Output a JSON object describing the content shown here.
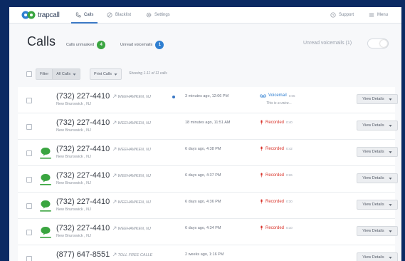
{
  "brand": {
    "name": "trapcall"
  },
  "nav": {
    "items": [
      {
        "label": "Calls",
        "icon": "phone-icon",
        "active": true
      },
      {
        "label": "Blacklist",
        "icon": "block-icon",
        "active": false
      },
      {
        "label": "Settings",
        "icon": "gear-icon",
        "active": false
      }
    ],
    "support": "Support",
    "menu": "Menu"
  },
  "header": {
    "title": "Calls",
    "calls_unmasked_label": "Calls unmasked",
    "calls_unmasked_count": "4",
    "unread_voicemails_label": "Unread voicemails",
    "unread_voicemails_count": "1",
    "unread_toggle_label": "Unread voicemails (1)"
  },
  "filter": {
    "filter_label": "Filter",
    "selected": "All Calls",
    "print_label": "Print Calls",
    "showing_text": "Showing 1-11 of 11 calls"
  },
  "calls": [
    {
      "phone": "(732) 227-4410",
      "location": "New Brunswick , NJ",
      "carrier": "WEEHAWKEN, NJ",
      "time": "3 minutes ago, 12:06 PM",
      "status": "Voicemail",
      "status_type": "voicemail",
      "duration": "0:05",
      "snippet": "This is a voice...",
      "unmasked": false,
      "unread": true,
      "action": "View Details"
    },
    {
      "phone": "(732) 227-4410",
      "location": "New Brunswick , NJ",
      "carrier": "WEEHAWKEN, NJ",
      "time": "18 minutes ago, 11:51 AM",
      "status": "Recorded",
      "status_type": "recorded",
      "duration": "0:40",
      "snippet": "",
      "unmasked": false,
      "unread": false,
      "action": "View Details"
    },
    {
      "phone": "(732) 227-4410",
      "location": "New Brunswick , NJ",
      "carrier": "WEEHAWKEN, NJ",
      "time": "6 days ago, 4:38 PM",
      "status": "Recorded",
      "status_type": "recorded",
      "duration": "0:42",
      "snippet": "",
      "unmasked": true,
      "unread": false,
      "action": "View Details"
    },
    {
      "phone": "(732) 227-4410",
      "location": "New Brunswick , NJ",
      "carrier": "WEEHAWKEN, NJ",
      "time": "6 days ago, 4:37 PM",
      "status": "Recorded",
      "status_type": "recorded",
      "duration": "0:26",
      "snippet": "",
      "unmasked": true,
      "unread": false,
      "action": "View Details"
    },
    {
      "phone": "(732) 227-4410",
      "location": "New Brunswick , NJ",
      "carrier": "WEEHAWKEN, NJ",
      "time": "6 days ago, 4:36 PM",
      "status": "Recorded",
      "status_type": "recorded",
      "duration": "0:30",
      "snippet": "",
      "unmasked": true,
      "unread": false,
      "action": "View Details"
    },
    {
      "phone": "(732) 227-4410",
      "location": "New Brunswick , NJ",
      "carrier": "WEEHAWKEN, NJ",
      "time": "6 days ago, 4:34 PM",
      "status": "Recorded",
      "status_type": "recorded",
      "duration": "0:10",
      "snippet": "",
      "unmasked": true,
      "unread": false,
      "action": "View Details"
    },
    {
      "phone": "(877) 647-8551",
      "location": "",
      "carrier": "TOLL FREE CALLE",
      "time": "2 weeks ago, 1:16 PM",
      "status": "",
      "status_type": "",
      "duration": "",
      "snippet": "",
      "unmasked": false,
      "unread": false,
      "action": "View Details"
    }
  ],
  "colors": {
    "voicemail": "#2f7fd1",
    "recorded": "#d9342b",
    "unmasked": "#3aa540",
    "unread": "#2f7fd1",
    "toolbar_bg": "#0b2a63"
  }
}
